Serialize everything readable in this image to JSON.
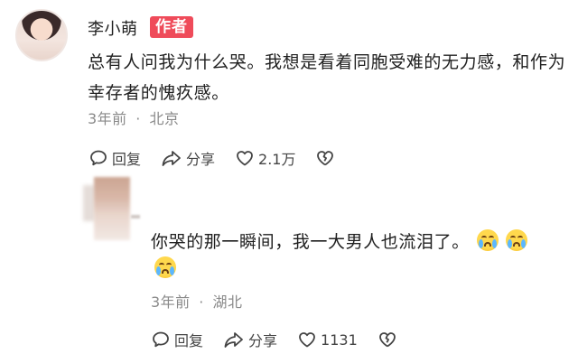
{
  "comment": {
    "author": "李小萌",
    "badge": "作者",
    "text": "总有人问我为什么哭。我想是看着同胞受难的无力感，和作为幸存者的愧疚感。",
    "time": "3年前",
    "separator": "·",
    "location": "北京",
    "actions": {
      "reply_label": "回复",
      "share_label": "分享",
      "like_count": "2.1万"
    }
  },
  "reply": {
    "text": "你哭的那一瞬间，我一大男人也流泪了。",
    "emojis": [
      "crying-face",
      "crying-face",
      "crying-face"
    ],
    "time": "3年前",
    "separator": "·",
    "location": "湖北",
    "actions": {
      "reply_label": "回复",
      "share_label": "分享",
      "like_count": "1131"
    }
  },
  "colors": {
    "badge": "#ef4b5a",
    "meta": "#8a8a8a",
    "text": "#202020"
  }
}
